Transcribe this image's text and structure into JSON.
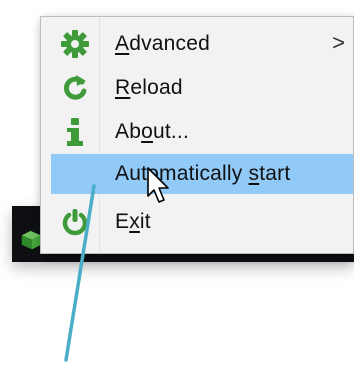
{
  "colors": {
    "icon_green": "#3f9a3a",
    "highlight": "#91c9f7",
    "annotation": "#4aaec6",
    "menu_bg": "#f2f2f2",
    "taskbar": "#0e0f13"
  },
  "menu": {
    "items": [
      {
        "label_prefix": "",
        "mnemonic": "A",
        "label_suffix": "dvanced",
        "icon": "gear-icon",
        "has_submenu": true,
        "submenu_arrow": ">"
      },
      {
        "label_prefix": "",
        "mnemonic": "R",
        "label_suffix": "eload",
        "icon": "reload-icon",
        "has_submenu": false
      },
      {
        "label_prefix": "Ab",
        "mnemonic": "o",
        "label_suffix": "ut...",
        "icon": "info-icon",
        "has_submenu": false
      },
      {
        "label_prefix": "Automatically ",
        "mnemonic": "s",
        "label_suffix": "tart",
        "icon": "",
        "has_submenu": false,
        "highlighted": true
      },
      {
        "label_prefix": "E",
        "mnemonic": "x",
        "label_suffix": "it",
        "icon": "power-icon",
        "has_submenu": false
      }
    ]
  },
  "taskbar": {
    "tray_icons": [
      "app-cube-icon",
      "tray-icon",
      "shield-icon",
      "chat-icon",
      "shield-check-icon",
      "trash-icon"
    ]
  }
}
